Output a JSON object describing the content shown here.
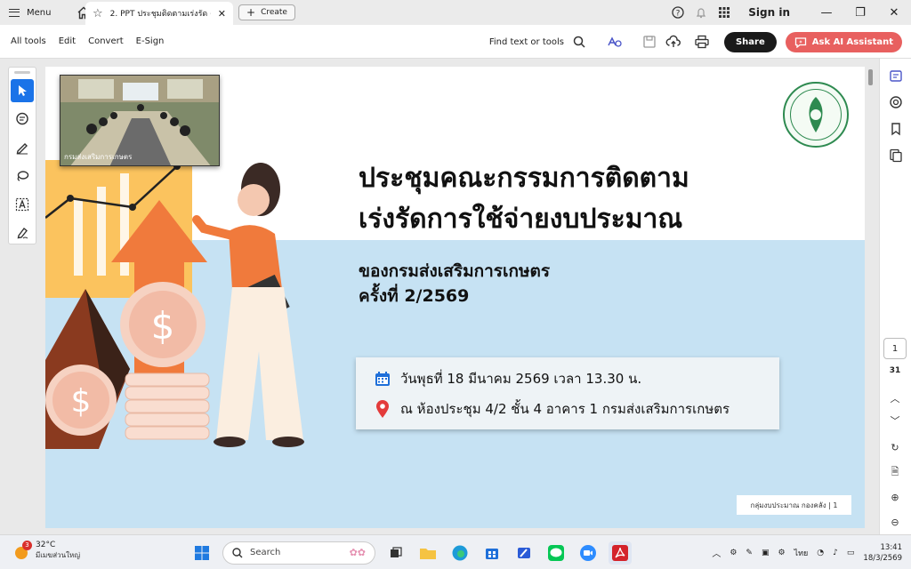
{
  "titlebar": {
    "menu_label": "Menu",
    "tab_title": "2. PPT ประชุมติดตามเร่งรัด ค...",
    "create_label": "Create",
    "signin_label": "Sign in"
  },
  "toolbar": {
    "items": [
      "All tools",
      "Edit",
      "Convert",
      "E-Sign"
    ],
    "find_label": "Find text or tools",
    "share_label": "Share",
    "ask_ai_label": "Ask AI Assistant"
  },
  "slide": {
    "video_label": "กรมส่งเสริมการเกษตร",
    "title_line1": "ประชุมคณะกรรมการติดตาม",
    "title_line2": "เร่งรัดการใช้จ่ายงบประมาณ",
    "subtitle_line1": "ของกรมส่งเสริมการเกษตร",
    "subtitle_line2": "ครั้งที่ 2/2569",
    "date_text": "วันพุธที่ 18 มีนาคม 2569 เวลา 13.30 น.",
    "location_text": "ณ ห้องประชุม 4/2 ชั้น 4 อาคาร 1 กรมส่งเสริมการเกษตร",
    "footer_text": "กลุ่มงบประมาณ กองคลัง | 1",
    "accent_blue": "#c6e2f3",
    "accent_orange": "#f07a3c"
  },
  "pagenav": {
    "current_page": "1",
    "total_pages": "31"
  },
  "taskbar": {
    "weather_temp": "32°C",
    "weather_desc": "มีเมฆส่วนใหญ่",
    "weather_badge": "3",
    "search_placeholder": "Search",
    "language": "ไทย",
    "time": "13:41",
    "date": "18/3/2569"
  }
}
